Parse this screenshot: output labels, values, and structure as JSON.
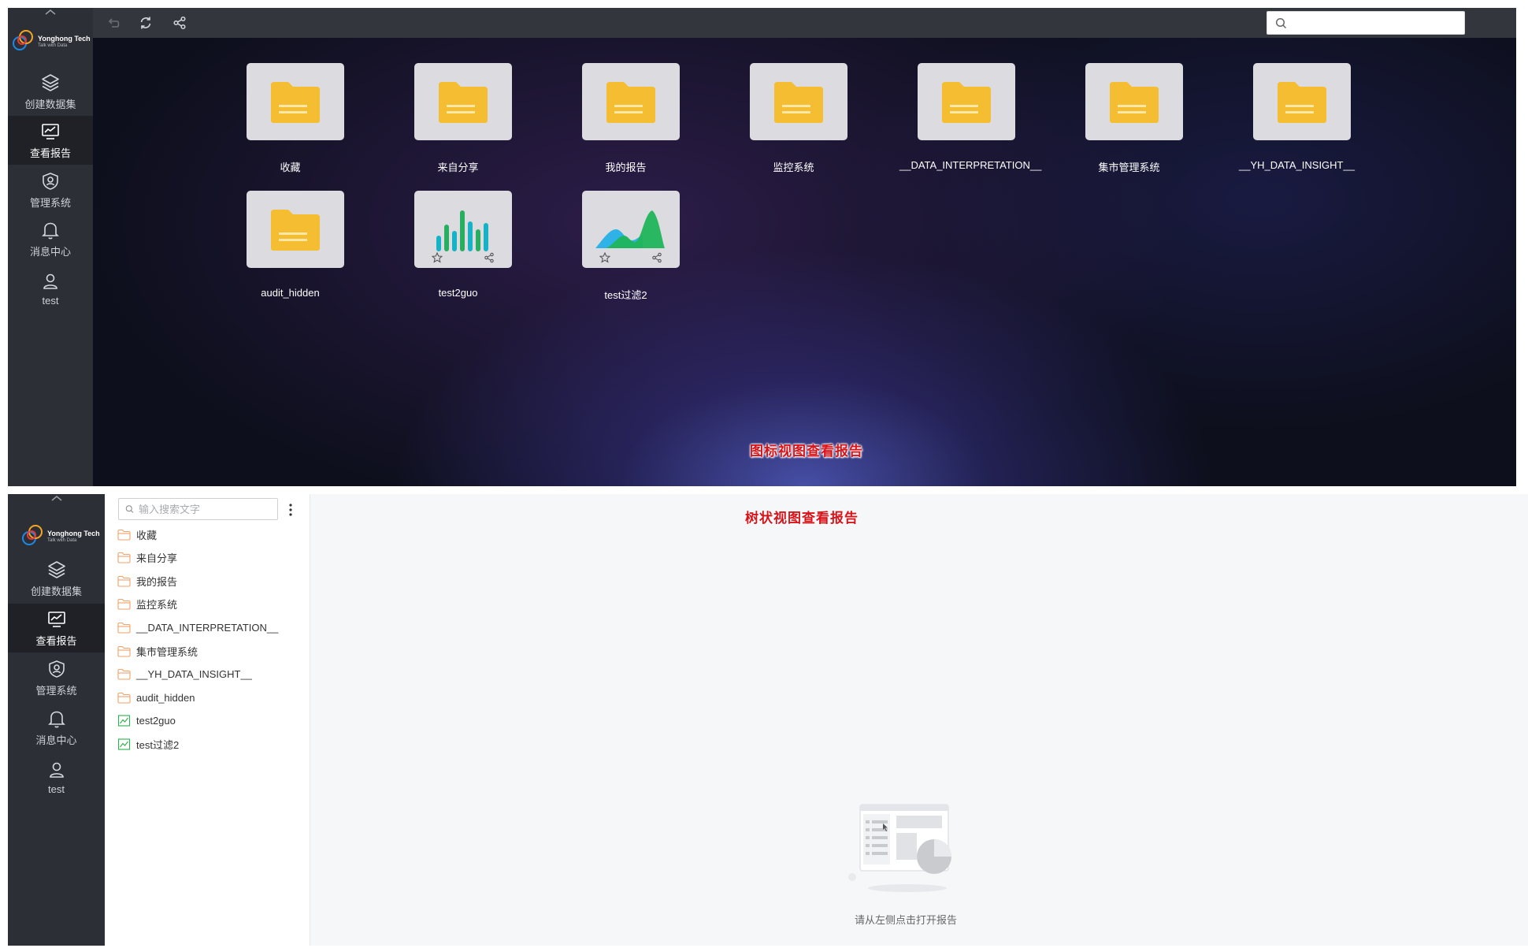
{
  "logo": {
    "name": "Yonghong Tech",
    "tagline": "Talk with Data"
  },
  "nav": [
    {
      "label": "创建数据集",
      "icon": "layers-icon"
    },
    {
      "label": "查看报告",
      "icon": "report-monitor-icon",
      "active": true
    },
    {
      "label": "管理系统",
      "icon": "shield-user-icon"
    },
    {
      "label": "消息中心",
      "icon": "bell-icon"
    },
    {
      "label": "test",
      "icon": "user-icon"
    }
  ],
  "toolbar": {
    "undo": "undo-icon",
    "refresh": "refresh-icon",
    "share": "share-icon",
    "search_icon": "search-icon"
  },
  "icon_view": {
    "items": [
      {
        "label": "收藏",
        "type": "folder"
      },
      {
        "label": "来自分享",
        "type": "folder"
      },
      {
        "label": "我的报告",
        "type": "folder"
      },
      {
        "label": "监控系统",
        "type": "folder"
      },
      {
        "label": "__DATA_INTERPRETATION__",
        "type": "folder"
      },
      {
        "label": "集市管理系统",
        "type": "folder"
      },
      {
        "label": "__YH_DATA_INSIGHT__",
        "type": "folder"
      },
      {
        "label": "audit_hidden",
        "type": "folder"
      },
      {
        "label": "test2guo",
        "type": "bar-report"
      },
      {
        "label": "test过滤2",
        "type": "area-report"
      }
    ],
    "annotation": "图标视图查看报告",
    "colors": {
      "folder": "#f5be32",
      "folder_stripe": "#fbe7a6",
      "bar": "#16b2c6",
      "bar_alt": "#27ae60",
      "area_blue": "#2fb2e6",
      "area_green": "#1fb55a"
    }
  },
  "tree_view": {
    "search_placeholder": "输入搜索文字",
    "annotation": "树状视图查看报告",
    "items": [
      {
        "label": "收藏",
        "type": "folder"
      },
      {
        "label": "来自分享",
        "type": "folder"
      },
      {
        "label": "我的报告",
        "type": "folder"
      },
      {
        "label": "监控系统",
        "type": "folder"
      },
      {
        "label": "__DATA_INTERPRETATION__",
        "type": "folder"
      },
      {
        "label": "集市管理系统",
        "type": "folder"
      },
      {
        "label": "__YH_DATA_INSIGHT__",
        "type": "folder"
      },
      {
        "label": "audit_hidden",
        "type": "folder"
      },
      {
        "label": "test2guo",
        "type": "report"
      },
      {
        "label": "test过滤2",
        "type": "report"
      }
    ],
    "empty_text": "请从左侧点击打开报告",
    "colors": {
      "folder_outline": "#f0a36b",
      "report_icon": "#2bb24c"
    }
  }
}
